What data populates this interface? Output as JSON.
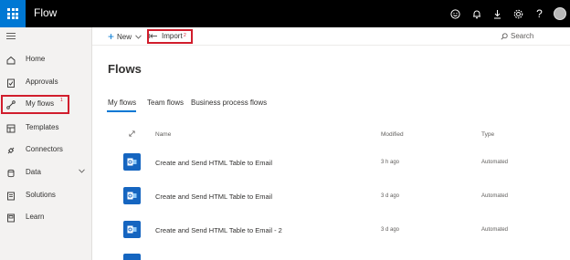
{
  "app": {
    "title": "Flow"
  },
  "topbar": {
    "icons": [
      "smiley-icon",
      "bell-icon",
      "download-icon",
      "gear-icon",
      "help-icon",
      "avatar"
    ]
  },
  "help_label": "?",
  "sidebar": {
    "items": [
      {
        "label": "Home",
        "icon": "home-icon"
      },
      {
        "label": "Approvals",
        "icon": "approvals-icon"
      },
      {
        "label": "My flows",
        "icon": "flow-icon",
        "selected": true,
        "annotation": "1"
      },
      {
        "label": "Templates",
        "icon": "templates-icon"
      },
      {
        "label": "Connectors",
        "icon": "connectors-icon"
      },
      {
        "label": "Data",
        "icon": "data-icon",
        "expandable": true
      },
      {
        "label": "Solutions",
        "icon": "solutions-icon"
      },
      {
        "label": "Learn",
        "icon": "learn-icon"
      }
    ]
  },
  "commandbar": {
    "new_label": "New",
    "import_label": "Import",
    "import_annotation": "2",
    "search_label": "Search"
  },
  "main": {
    "title": "Flows",
    "tabs": [
      {
        "label": "My flows",
        "active": true
      },
      {
        "label": "Team flows"
      },
      {
        "label": "Business process flows"
      }
    ],
    "columns": {
      "name": "Name",
      "modified": "Modified",
      "type": "Type"
    },
    "rows": [
      {
        "name": "Create and Send HTML Table to Email",
        "modified": "3 h ago",
        "type": "Automated"
      },
      {
        "name": "Create and Send HTML Table to Email",
        "modified": "3 d ago",
        "type": "Automated"
      },
      {
        "name": "Create and Send HTML Table to Email - 2",
        "modified": "3 d ago",
        "type": "Automated"
      }
    ]
  },
  "colors": {
    "accent": "#0078d4",
    "highlight": "#d11d2c",
    "row_icon": "#1565c0",
    "topbar": "#000000"
  }
}
